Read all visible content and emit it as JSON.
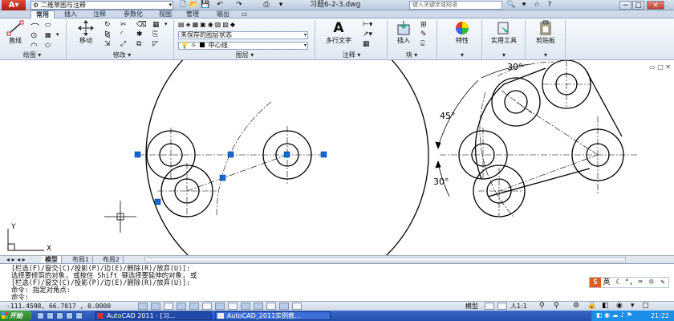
{
  "titlebar": {
    "workspace": "二维草图与注释",
    "document_title": "习题6-2-3.dwg",
    "search_placeholder": "键入关键字或短语",
    "buttons": [
      "−",
      "□",
      "×"
    ]
  },
  "ribbon_tabs": [
    "常用",
    "插入",
    "注释",
    "参数化",
    "视图",
    "管理",
    "输出"
  ],
  "ribbon": {
    "draw": {
      "title": "绘图",
      "line_label": "直线"
    },
    "modify": {
      "title": "修改",
      "move_label": "移动"
    },
    "layers": {
      "title": "图层",
      "layer_state": "未保存的图层状态",
      "current_layer": "中心线"
    },
    "annotation": {
      "title": "注释",
      "mtext_label": "多行文字"
    },
    "block": {
      "title": "块",
      "insert_label": "插入"
    },
    "properties_label": "特性",
    "utilities_label": "实用工具",
    "clipboard_label": "剪贴板"
  },
  "drawing": {
    "angle_30_top": "30°",
    "angle_45": "45°",
    "angle_30_bottom": "30°",
    "ucs_x": "X",
    "ucs_y": "Y"
  },
  "layout_tabs": [
    "模型",
    "布局1",
    "布局2"
  ],
  "command_lines": [
    "[栏选(F)/窗交(C)/投影(P)/边(E)/删除(R)/放弃(U)]:",
    "选择要修剪的对象, 或按住 Shift 键选择要延伸的对象, 或",
    "[栏选(F)/窗交(C)/投影(P)/边(E)/删除(R)/放弃(U)]:",
    "命令: 指定对角点:",
    "命令:"
  ],
  "ime": {
    "label": "英"
  },
  "status": {
    "coordinates": "-111.4598, 66.7017 , 0.0000",
    "model_label": "模型",
    "scale": "人1:1"
  },
  "taskbar": {
    "start_label": "开始",
    "tasks": [
      "AutoCAD 2011 - [习...",
      "AutoCAD_2011实例教..."
    ],
    "clock": "21:22"
  }
}
